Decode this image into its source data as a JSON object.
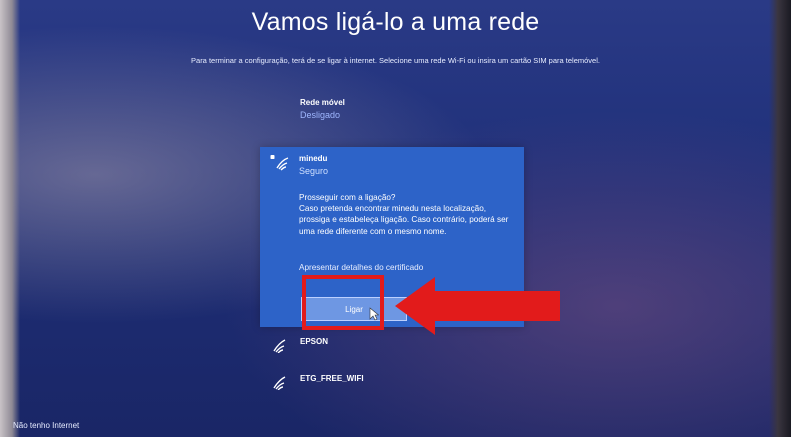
{
  "window": {
    "title": "Vamos ligá-lo a uma rede",
    "subtitle": "Para terminar a configuração, terá de se ligar à internet. Selecione uma rede Wi-Fi ou insira um cartão SIM para telemóvel."
  },
  "networks": [
    {
      "name": "Rede móvel",
      "status": "Desligado",
      "icon": "mobile-network-icon"
    },
    {
      "name": "minedu",
      "status": "Seguro",
      "icon": "wifi-secure-icon",
      "prompt": "Prosseguir com a ligação?\nCaso pretenda encontrar minedu nesta localização, prossiga e estabeleça ligação. Caso contrário, poderá ser uma rede diferente com o mesmo nome.",
      "cert_link": "Apresentar detalhes do certificado",
      "connect_label": "Ligar"
    },
    {
      "name": "EPSON",
      "icon": "wifi-icon"
    },
    {
      "name": "ETG_FREE_WIFI",
      "icon": "wifi-icon"
    }
  ],
  "footer": {
    "no_internet_label": "Não tenho Internet"
  },
  "annotation": {
    "highlight_color": "#e21b1b",
    "arrow_color": "#e21b1b"
  },
  "colors": {
    "accent": "#2d63c8",
    "status_blue": "#9fb7ff",
    "button": "#6e97e3"
  }
}
